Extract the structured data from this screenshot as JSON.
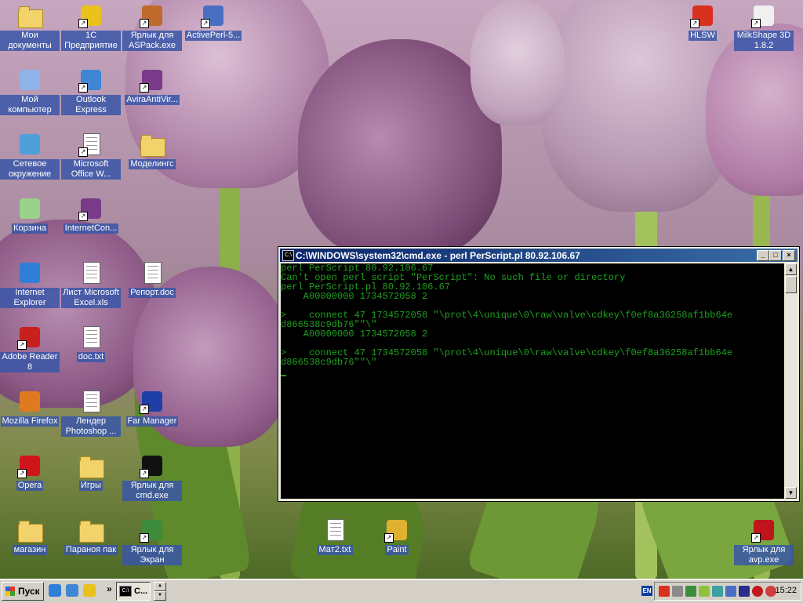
{
  "desktop": {
    "icons": [
      {
        "key": "my-documents",
        "label": "Мои документы",
        "kind": "folder"
      },
      {
        "key": "1c",
        "label": "1С Предприятие",
        "kind": "app",
        "color": "#e9c21c"
      },
      {
        "key": "aspack",
        "label": "Ярлык для ASPack.exe",
        "kind": "app",
        "color": "#c06a2b"
      },
      {
        "key": "activeperl",
        "label": "ActivePerl-5...",
        "kind": "app",
        "color": "#4a6fc2"
      },
      {
        "key": "hlsw",
        "label": "HLSW",
        "kind": "app",
        "color": "#d8321e"
      },
      {
        "key": "milkshape",
        "label": "MilkShape 3D 1.8.2",
        "kind": "app",
        "color": "#f0f0f0"
      },
      {
        "key": "my-computer",
        "label": "Мой компьютер",
        "kind": "app",
        "color": "#8db3e8"
      },
      {
        "key": "outlook",
        "label": "Outlook Express",
        "kind": "app",
        "color": "#3f86d6"
      },
      {
        "key": "avira",
        "label": "AviraAntiVir...",
        "kind": "app",
        "color": "#7a3a8a"
      },
      {
        "key": "network",
        "label": "Сетевое окружение",
        "kind": "app",
        "color": "#4fa0d8"
      },
      {
        "key": "word",
        "label": "Microsoft Office W...",
        "kind": "doc"
      },
      {
        "key": "modelings",
        "label": "Моделингс",
        "kind": "folder"
      },
      {
        "key": "recycle",
        "label": "Корзина",
        "kind": "app",
        "color": "#9ad28a"
      },
      {
        "key": "internetcon",
        "label": "InternetCon...",
        "kind": "app",
        "color": "#7a3a8a"
      },
      {
        "key": "ie",
        "label": "Internet Explorer",
        "kind": "app",
        "color": "#2f7fd9"
      },
      {
        "key": "excel",
        "label": "Лист Microsoft Excel.xls",
        "kind": "doc"
      },
      {
        "key": "report",
        "label": "Репорт.doc",
        "kind": "doc"
      },
      {
        "key": "adobe",
        "label": "Adobe Reader 8",
        "kind": "app",
        "color": "#c8201c"
      },
      {
        "key": "doctxt",
        "label": "doc.txt",
        "kind": "doc"
      },
      {
        "key": "firefox",
        "label": "Mozilla Firefox",
        "kind": "app",
        "color": "#e07a20"
      },
      {
        "key": "lender",
        "label": "Лендер Photoshop ...",
        "kind": "doc"
      },
      {
        "key": "farmanager",
        "label": "Far Manager",
        "kind": "app",
        "color": "#1f3fa8"
      },
      {
        "key": "opera",
        "label": "Opera",
        "kind": "app",
        "color": "#d0141c"
      },
      {
        "key": "games",
        "label": "Игры",
        "kind": "folder"
      },
      {
        "key": "cmdlink",
        "label": "Ярлык для cmd.exe",
        "kind": "app",
        "color": "#111111"
      },
      {
        "key": "shop",
        "label": "магазин",
        "kind": "folder"
      },
      {
        "key": "paranoia",
        "label": "Параноя пак",
        "kind": "folder"
      },
      {
        "key": "screenlink",
        "label": "Ярлык для Экран",
        "kind": "app",
        "color": "#3c8c3c"
      },
      {
        "key": "mat2",
        "label": "Мат2.txt",
        "kind": "doc"
      },
      {
        "key": "paint",
        "label": "Paint",
        "kind": "app",
        "color": "#e0b030"
      },
      {
        "key": "avp",
        "label": "Ярлык для avp.exe",
        "kind": "app",
        "color": "#c0141c"
      }
    ]
  },
  "console": {
    "title": "C:\\WINDOWS\\system32\\cmd.exe - perl PerScript.pl 80.92.106.67",
    "system_icon": "C:\\",
    "minimize": "_",
    "maximize": "□",
    "close": "×",
    "lines": [
      "perl PerScript 80.92.106.67",
      "Can't open perl script \"PerScript\": No such file or directory",
      "perl PerScript.pl 80.92.106.67",
      "    A00000000 1734572058 2",
      "",
      ">    connect 47 1734572058 \"\\prot\\4\\unique\\0\\raw\\valve\\cdkey\\f0ef8a36258af1bb64e",
      "d866538c9db76\"\"\\\"",
      "    A00000000 1734572058 2",
      "",
      ">    connect 47 1734572058 \"\\prot\\4\\unique\\0\\raw\\valve\\cdkey\\f0ef8a36258af1bb64e",
      "d866538c9db76\"\"\\\""
    ],
    "text_color": "#1fa01f"
  },
  "taskbar": {
    "start_label": "Пуск",
    "chevron": "»",
    "task_label": "C...",
    "task_icon": "C:\\",
    "spin_up": "▲",
    "spin_down": "▼",
    "language": "EN",
    "clock": "15:22"
  }
}
